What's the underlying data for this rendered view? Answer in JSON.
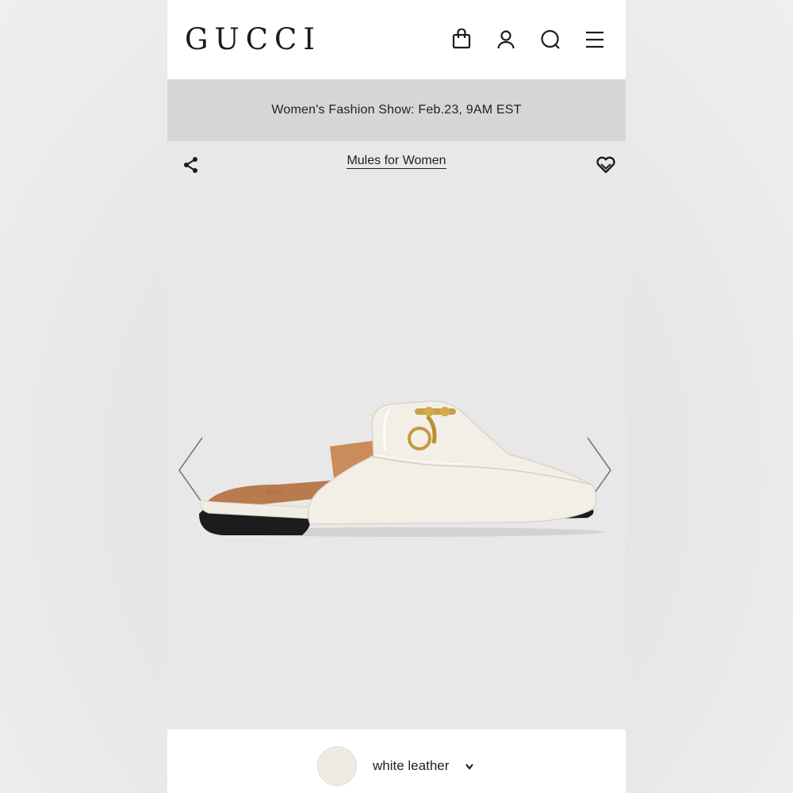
{
  "header": {
    "logo": "GUCCI",
    "icons": [
      "shopping-bag-icon",
      "account-icon",
      "search-icon",
      "menu-icon"
    ]
  },
  "banner": {
    "text": "Women's Fashion Show: Feb.23, 9AM EST"
  },
  "product": {
    "breadcrumb": "Mules for Women",
    "actions": [
      "share-icon",
      "wishlist-heart-icon"
    ],
    "image": "white-leather-horsebit-mule",
    "carousel": [
      "previous-arrow-icon",
      "next-arrow-icon"
    ]
  },
  "variant": {
    "color_label": "white leather",
    "swatch_color": "#efebe2"
  },
  "colors": {
    "banner_bg": "#d6d6d6",
    "hero_bg": "#e8e8e8",
    "text": "#1b1b1b"
  }
}
